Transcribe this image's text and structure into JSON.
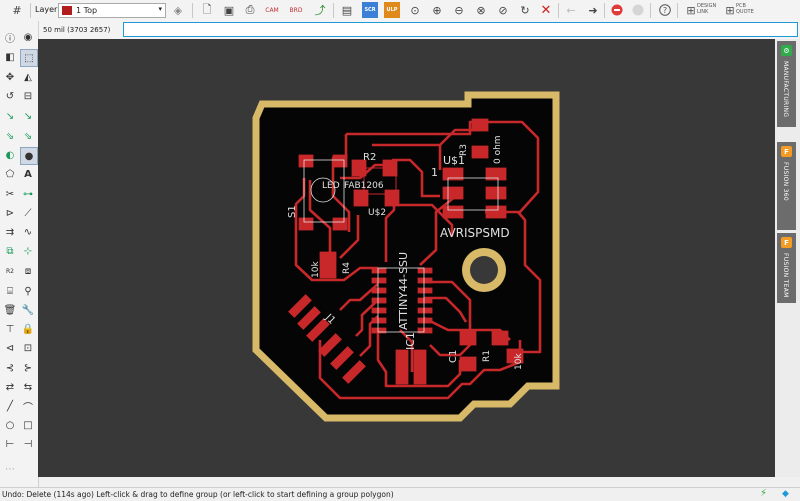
{
  "toolbar": {
    "layer_label": "Layer:",
    "layer_value": "1 Top",
    "layer_color": "#b21c1c",
    "design_link": "DESIGN LINK",
    "pcb_quote": "PCB QUOTE",
    "scr_label": "SCR",
    "ulp_label": "ULP"
  },
  "coordinates": "50 mil (3703 2657)",
  "command": {
    "value": ""
  },
  "right_panel": {
    "tabs": [
      {
        "label": "MANUFACTURING",
        "icon": "manufacturing-icon"
      },
      {
        "label": "FUSION 360",
        "icon": "fusion-icon",
        "glyph": "F"
      },
      {
        "label": "FUSION TEAM",
        "icon": "fusion-team-icon",
        "glyph": "F"
      }
    ]
  },
  "board": {
    "labels": {
      "s1": "S1",
      "r2": "R2",
      "led": "LED",
      "fab": "FAB1206",
      "r3": "R3",
      "ohm0": "0 ohm",
      "u1": "U$1",
      "one": "1",
      "u2": "U$2",
      "avr": "AVRISPSMD",
      "k10a": "10k",
      "r4": "R4",
      "ic": "ATTINY44-SSU",
      "ic1": "IC1",
      "j1": "J1",
      "c1": "C1",
      "r1": "R1",
      "k10b": "10k"
    }
  },
  "status": {
    "text": "Undo: Delete (114s ago) Left-click & drag to define group (or left-click to start defining a group polygon)"
  },
  "colors": {
    "canvas": "#383838",
    "board_outline": "#d8b968",
    "copper": "#c8282a",
    "accent": "#1e9bd7",
    "stop_red": "#e03a3a"
  }
}
